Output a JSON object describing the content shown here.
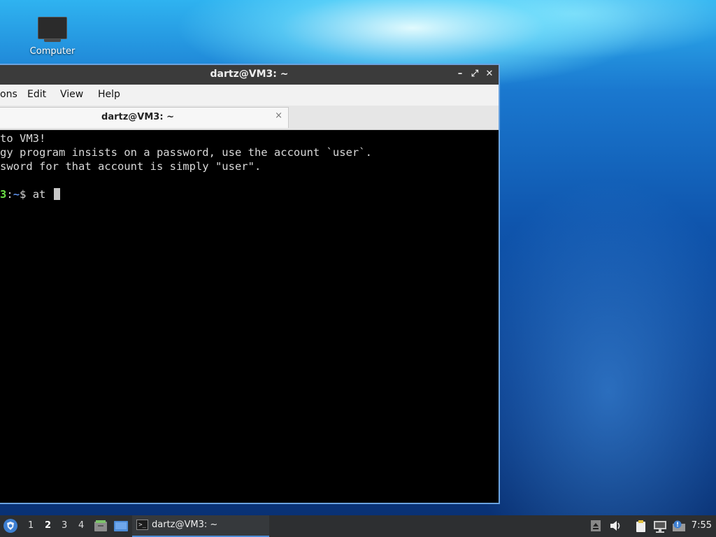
{
  "desktop": {
    "icons": [
      {
        "label": "Computer",
        "icon": "computer-icon"
      }
    ]
  },
  "window": {
    "title": "dartz@VM3: ~",
    "controls": {
      "minimize": "–",
      "maximize": "⤢",
      "close": "✕"
    },
    "menus": [
      "ons",
      "Edit",
      "View",
      "Help"
    ],
    "tabs": [
      {
        "label": "dartz@VM3: ~",
        "close": "×"
      }
    ]
  },
  "terminal": {
    "lines": [
      "to VM3!",
      "gy program insists on a password, use the account `user`.",
      "sword for that account is simply \"user\"."
    ],
    "prompt": {
      "host_tail": "3",
      "sep": ":",
      "path": "~",
      "symbol": "$",
      "command": "at"
    }
  },
  "taskbar": {
    "workspaces": [
      "1",
      "2",
      "3",
      "4"
    ],
    "active_workspace": "2",
    "task": {
      "label": "dartz@VM3: ~",
      "icon": ">_"
    },
    "clock": "7:55"
  }
}
